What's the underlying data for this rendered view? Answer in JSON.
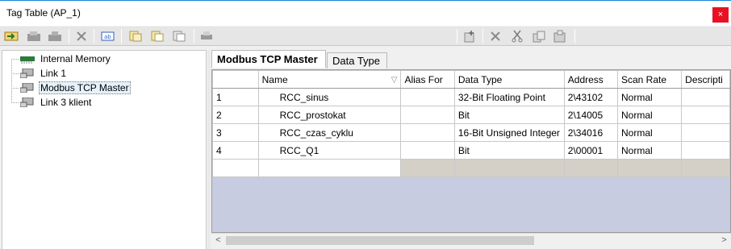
{
  "window": {
    "title": "Tag Table (AP_1)",
    "close_glyph": "×"
  },
  "toolbar": {
    "buttons": [
      "add-tag-icon",
      "import-icon",
      "export-icon",
      "delete-icon",
      "rename-icon",
      "copy-icon",
      "paste-icon",
      "paste-special-icon",
      "print-icon",
      "new-row-icon",
      "delete-row-icon",
      "cut-icon",
      "copy-row-icon",
      "paste-row-icon"
    ]
  },
  "tree": {
    "items": [
      {
        "label": "Internal Memory",
        "icon": "memory-icon",
        "selected": false
      },
      {
        "label": "Link 1",
        "icon": "network-icon",
        "selected": false
      },
      {
        "label": "Modbus TCP Master",
        "icon": "network-icon",
        "selected": true
      },
      {
        "label": "Link 3 klient",
        "icon": "network-icon",
        "selected": false
      }
    ]
  },
  "tabs": [
    {
      "label": "Modbus TCP Master",
      "active": true
    },
    {
      "label": "Data Type",
      "active": false
    }
  ],
  "table": {
    "columns": [
      "",
      "Name",
      "Alias For",
      "Data Type",
      "Address",
      "Scan Rate",
      "Descripti"
    ],
    "sort_glyph": "▽",
    "rows": [
      {
        "num": "1",
        "name": "RCC_sinus",
        "alias": "",
        "type": "32-Bit Floating Point",
        "address": "2\\43102",
        "scan": "Normal",
        "desc": ""
      },
      {
        "num": "2",
        "name": "RCC_prostokat",
        "alias": "",
        "type": "Bit",
        "address": "2\\14005",
        "scan": "Normal",
        "desc": ""
      },
      {
        "num": "3",
        "name": "RCC_czas_cyklu",
        "alias": "",
        "type": "16-Bit Unsigned Integer",
        "address": "2\\34016",
        "scan": "Normal",
        "desc": ""
      },
      {
        "num": "4",
        "name": "RCC_Q1",
        "alias": "",
        "type": "Bit",
        "address": "2\\00001",
        "scan": "Normal",
        "desc": ""
      }
    ]
  },
  "scrollbar": {
    "left_glyph": "<",
    "right_glyph": ">"
  },
  "colors": {
    "accent": "#1883d7",
    "close": "#e81123",
    "grid_empty": "#c8cce0",
    "new_row": "#d4d0c8"
  }
}
